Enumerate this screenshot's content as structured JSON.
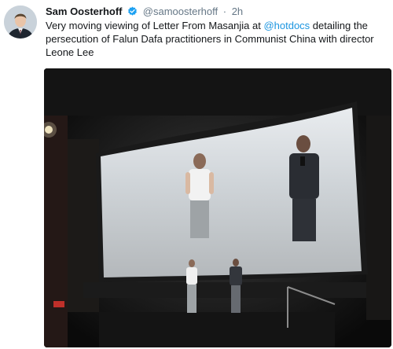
{
  "tweet": {
    "author_name": "Sam Oosterhoff",
    "handle": "@samoosterhoff",
    "separator": "·",
    "time": "2h",
    "text_before": "Very moving viewing of Letter From Masanjia at ",
    "mention": "@hotdocs",
    "text_after": " detailing the persecution of Falun Dafa practitioners in Communist China with director Leone Lee"
  },
  "icons": {
    "verified": "verified-badge-icon"
  },
  "colors": {
    "link": "#1b95e0",
    "verified": "#1da1f2",
    "secondary_text": "#657786"
  }
}
